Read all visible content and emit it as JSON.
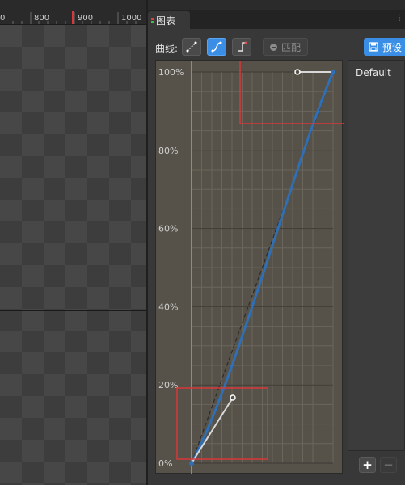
{
  "ruler": {
    "labels": [
      "0",
      "800",
      "900",
      "1000"
    ]
  },
  "tab": {
    "title": "图表"
  },
  "toolbar": {
    "curve_label": "曲线:",
    "match_label": "匹配",
    "preset_label": "预设"
  },
  "graph": {
    "y_labels": [
      "100%",
      "80%",
      "60%",
      "40%",
      "20%",
      "0%"
    ]
  },
  "presets": {
    "default_label": "Default"
  },
  "buttons": {
    "add": "+",
    "remove": "−"
  },
  "colors": {
    "accent": "#3a8ee6",
    "curve": "#2f6fb5",
    "cursor_line": "#35c6e8",
    "highlight_box": "#d8383b",
    "graph_bg": "#565249"
  }
}
